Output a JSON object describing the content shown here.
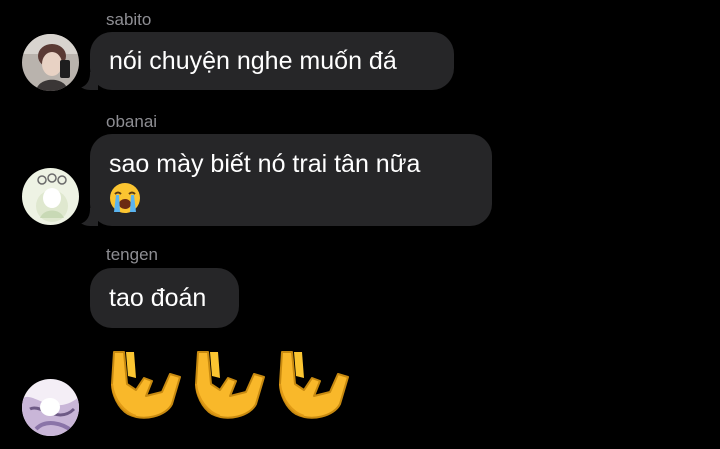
{
  "messages": [
    {
      "sender": "sabito",
      "text": "nói chuyện nghe muốn đá"
    },
    {
      "sender": "obanai",
      "text": "sao mày biết nó trai tân nữa",
      "emoji": "😭"
    },
    {
      "sender": "tengen",
      "text": "tao đoán"
    }
  ],
  "reaction_message": {
    "emoji": [
      "🤟",
      "🤟",
      "🤟"
    ],
    "icon": "love-you-gesture-icon"
  },
  "colors": {
    "background": "#000000",
    "bubble": "#262628",
    "sender_name": "#8e8e93",
    "text": "#ffffff"
  }
}
